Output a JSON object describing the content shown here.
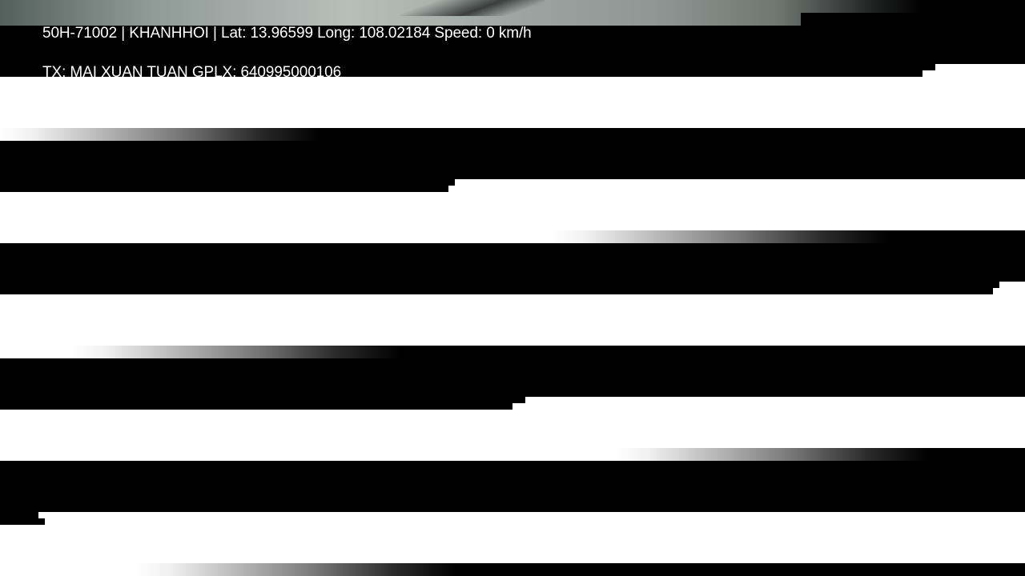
{
  "overlay": {
    "line1": "50H-71002 | KHANHHOI | Lat: 13.96599 Long: 108.02184 Speed: 0 km/h",
    "line2": "TX: MAI XUAN TUAN GPLX: 640995000106"
  },
  "colors": {
    "text": "#ffffff",
    "band_dark": "#000000",
    "band_light": "#ffffff"
  }
}
